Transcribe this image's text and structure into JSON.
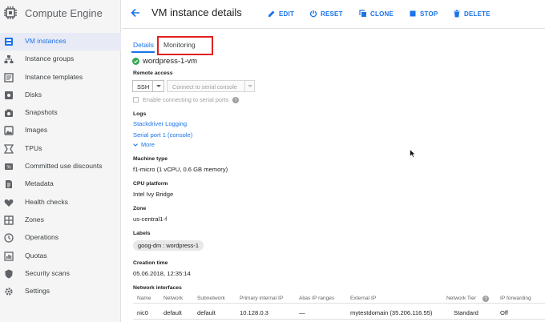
{
  "app": {
    "title": "Compute Engine"
  },
  "sidebar": {
    "items": [
      {
        "label": "VM instances",
        "icon": "vm-instances-icon",
        "active": true
      },
      {
        "label": "Instance groups",
        "icon": "instance-groups-icon"
      },
      {
        "label": "Instance templates",
        "icon": "instance-templates-icon"
      },
      {
        "label": "Disks",
        "icon": "disks-icon"
      },
      {
        "label": "Snapshots",
        "icon": "snapshots-icon"
      },
      {
        "label": "Images",
        "icon": "images-icon"
      },
      {
        "label": "TPUs",
        "icon": "tpus-icon"
      },
      {
        "label": "Committed use discounts",
        "icon": "committed-use-discounts-icon"
      },
      {
        "label": "Metadata",
        "icon": "metadata-icon"
      },
      {
        "label": "Health checks",
        "icon": "health-checks-icon"
      },
      {
        "label": "Zones",
        "icon": "zones-icon"
      },
      {
        "label": "Operations",
        "icon": "operations-icon"
      },
      {
        "label": "Quotas",
        "icon": "quotas-icon"
      },
      {
        "label": "Security scans",
        "icon": "security-scans-icon"
      },
      {
        "label": "Settings",
        "icon": "settings-icon"
      }
    ]
  },
  "header": {
    "title": "VM instance details",
    "actions": {
      "edit": "EDIT",
      "reset": "RESET",
      "clone": "CLONE",
      "stop": "STOP",
      "delete": "DELETE"
    }
  },
  "tabs": {
    "details": "Details",
    "monitoring": "Monitoring"
  },
  "instance": {
    "name": "wordpress-1-vm",
    "remote_access": {
      "label": "Remote access",
      "ssh": "SSH",
      "serial": "Connect to serial console",
      "enable_serial": "Enable connecting to serial ports"
    },
    "logs": {
      "label": "Logs",
      "stackdriver": "Stackdriver Logging",
      "serial_port": "Serial port 1 (console)",
      "more": "More"
    },
    "machine_type": {
      "label": "Machine type",
      "value": "f1-micro (1 vCPU, 0.6 GB memory)"
    },
    "cpu_platform": {
      "label": "CPU platform",
      "value": "Intel Ivy Bridge"
    },
    "zone": {
      "label": "Zone",
      "value": "us-central1-f"
    },
    "labels": {
      "label": "Labels",
      "chip": "goog-dm : wordpress-1"
    },
    "creation_time": {
      "label": "Creation time",
      "value": "05.06.2018, 12:35:14"
    }
  },
  "network": {
    "label": "Network interfaces",
    "columns": {
      "name": "Name",
      "network": "Network",
      "subnetwork": "Subnetwork",
      "primary_ip": "Primary internal IP",
      "alias_ip": "Alias IP ranges",
      "external_ip": "External IP",
      "tier": "Network Tier",
      "ip_forwarding": "IP forwarding"
    },
    "rows": [
      {
        "name": "nic0",
        "network": "default",
        "subnetwork": "default",
        "primary_ip": "10.128.0.3",
        "alias_ip": "—",
        "external_ip": "mytestdomain (35.206.116.55)",
        "tier": "Standard",
        "ip_forwarding": "Off"
      }
    ]
  },
  "colors": {
    "accent": "#1a73e8",
    "highlight": "#e02020",
    "status_ok": "#34a853"
  }
}
